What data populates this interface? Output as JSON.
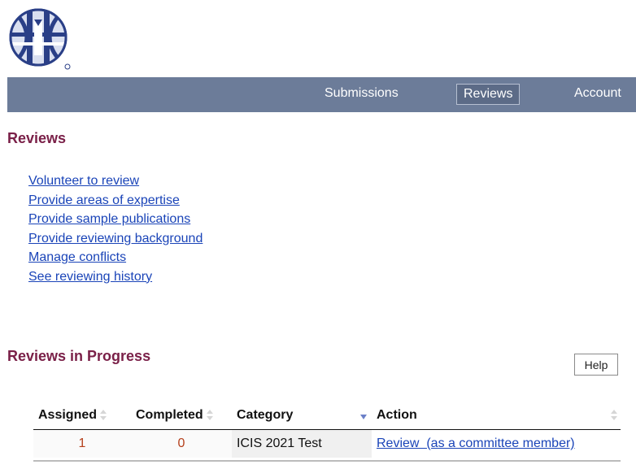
{
  "nav": {
    "items": [
      {
        "label": "Submissions"
      },
      {
        "label": "Reviews"
      },
      {
        "label": "Account"
      }
    ]
  },
  "reviews": {
    "title": "Reviews",
    "links": [
      {
        "label": "Volunteer to review"
      },
      {
        "label": "Provide areas of expertise"
      },
      {
        "label": "Provide sample publications"
      },
      {
        "label": "Provide reviewing background"
      },
      {
        "label": "Manage conflicts"
      },
      {
        "label": "See reviewing history"
      }
    ]
  },
  "progress": {
    "title": "Reviews in Progress",
    "help_label": "Help",
    "columns": [
      {
        "label": "Assigned"
      },
      {
        "label": "Completed"
      },
      {
        "label": "Category"
      },
      {
        "label": "Action"
      }
    ],
    "rows": [
      {
        "assigned": "1",
        "completed": "0",
        "category": "ICIS 2021 Test",
        "action": "Review  (as a committee member)"
      }
    ]
  },
  "colors": {
    "navbar": "#6c7c99",
    "heading": "#7a2048",
    "link": "#1a44b8",
    "count": "#b5401c"
  },
  "icons": {
    "logo": "globe-logo-icon"
  }
}
